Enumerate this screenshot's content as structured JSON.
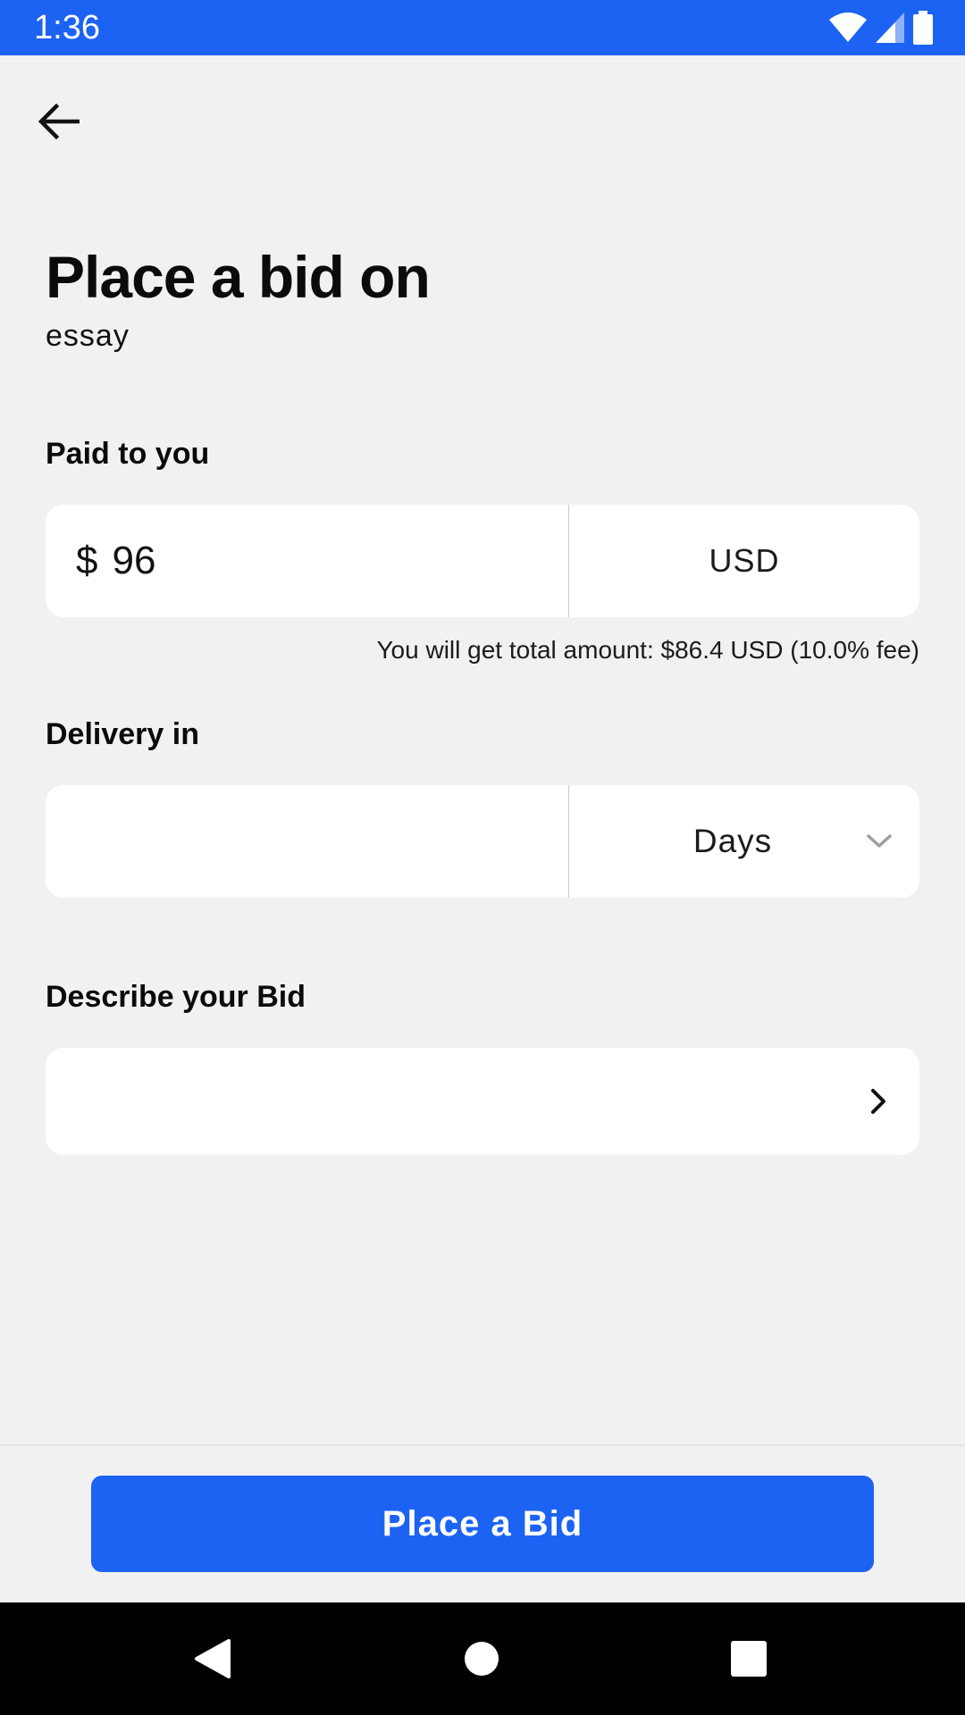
{
  "status_bar": {
    "time": "1:36",
    "icons": [
      "wifi-icon",
      "signal-icon",
      "battery-icon"
    ]
  },
  "header": {
    "back_icon": "arrow-left-icon"
  },
  "title": "Place a bid on",
  "subtitle": "essay",
  "paid": {
    "label": "Paid to you",
    "currency_symbol": "$",
    "amount": "96",
    "currency": "USD",
    "fee_note": "You will get total amount: $86.4 USD (10.0% fee)"
  },
  "delivery": {
    "label": "Delivery in",
    "value": "",
    "unit": "Days",
    "unit_icon": "chevron-down-icon"
  },
  "description": {
    "label": "Describe your Bid",
    "value": "",
    "icon": "chevron-right-icon"
  },
  "cta": {
    "label": "Place a Bid"
  },
  "nav": {
    "buttons": [
      "back-triangle-icon",
      "home-circle-icon",
      "recents-square-icon"
    ]
  },
  "colors": {
    "primary": "#1c63f3",
    "background": "#f1f1f1",
    "field": "#ffffff"
  }
}
